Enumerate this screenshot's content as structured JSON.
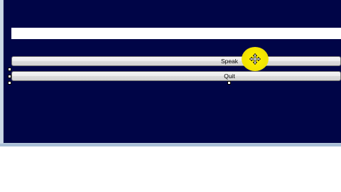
{
  "form": {
    "text_input_value": "",
    "speak_button_label": "Speak",
    "quit_button_label": "Quit"
  },
  "cursor": {
    "icon": "move-cursor-icon",
    "highlight_color": "#fff200"
  },
  "colors": {
    "form_background": "#000547",
    "window_frame": "#b9c9dc"
  }
}
